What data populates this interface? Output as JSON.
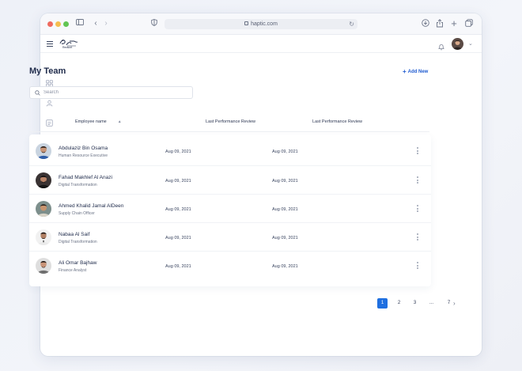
{
  "browser": {
    "url": "haptic.com"
  },
  "header": {
    "logo_text": "Redsort"
  },
  "page": {
    "title": "My Team",
    "add_new_label": "Add New",
    "search_placeholder": "Search"
  },
  "table": {
    "columns": [
      "Employee name",
      "Last Performance Review",
      "Last Performance Review"
    ],
    "rows": [
      {
        "name": "Abdulaziz Bin Osama",
        "role": "Human Resource Executive",
        "review1": "Aug 09, 2021",
        "review2": "Aug 09, 2021"
      },
      {
        "name": "Fahad Makhlef Al Anazi",
        "role": "Digital Transformation",
        "review1": "Aug 09, 2021",
        "review2": "Aug 09, 2021"
      },
      {
        "name": "Ahmed Khalid Jamal AlDeen",
        "role": "Supply Chain Officer",
        "review1": "Aug 09, 2021",
        "review2": "Aug 09, 2021"
      },
      {
        "name": "Nabaa Al Saif",
        "role": "Digital Transformation",
        "review1": "Aug 09, 2021",
        "review2": "Aug 09, 2021"
      },
      {
        "name": "Ali Omar Bajhaw",
        "role": "Finance Analyst",
        "review1": "Aug 09, 2021",
        "review2": "Aug 09, 2021"
      }
    ]
  },
  "pagination": {
    "pages": [
      "1",
      "2",
      "3",
      "...",
      "7"
    ],
    "current": "1"
  },
  "colors": {
    "accent": "#1f6fe0",
    "link": "#1f5bd0",
    "title": "#1e2a4a"
  }
}
